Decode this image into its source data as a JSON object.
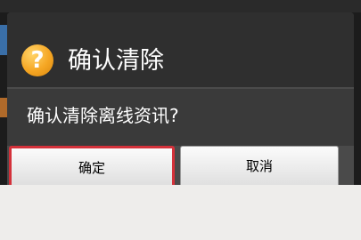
{
  "dialog": {
    "title": "确认清除",
    "icon": "question-mark-icon",
    "icon_glyph": "?",
    "message": "确认清除离线资讯?",
    "buttons": {
      "ok_label": "确定",
      "cancel_label": "取消"
    }
  },
  "colors": {
    "dialog_background": "#3a3a3a",
    "title_text": "#ffffff",
    "icon_orange": "#f5a623",
    "ok_border_highlight": "#d4313a",
    "button_face": "#f0f0f0",
    "bottom_area": "#eeedeb"
  }
}
